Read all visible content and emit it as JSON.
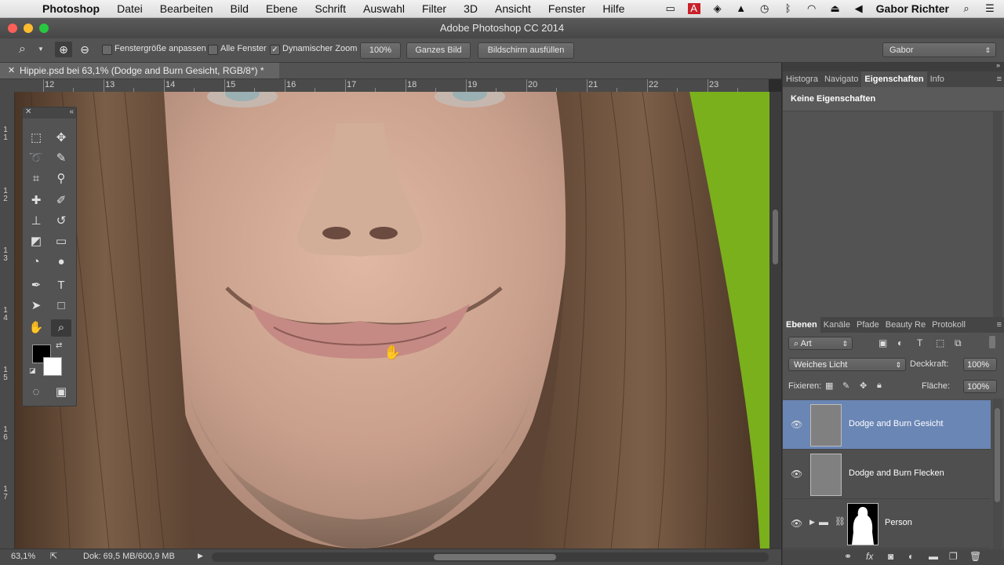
{
  "menubar": {
    "app": "Photoshop",
    "items": [
      "Datei",
      "Bearbeiten",
      "Bild",
      "Ebene",
      "Schrift",
      "Auswahl",
      "Filter",
      "3D",
      "Ansicht",
      "Fenster",
      "Hilfe"
    ],
    "user": "Gabor Richter"
  },
  "window": {
    "title": "Adobe Photoshop CC 2014"
  },
  "options": {
    "fit_window": "Fenstergröße anpassen",
    "all_windows": "Alle Fenster",
    "dynamic_zoom": "Dynamischer Zoom",
    "zoom_value": "100%",
    "fit_screen": "Ganzes Bild",
    "fill_screen": "Bildschirm ausfüllen",
    "workspace": "Gabor"
  },
  "document": {
    "tab_title": "Hippie.psd bei 63,1% (Dodge and Burn Gesicht, RGB/8*) *",
    "ruler_h": [
      "12",
      "13",
      "14",
      "15",
      "16",
      "17",
      "18",
      "19",
      "20",
      "21",
      "22",
      "23"
    ],
    "ruler_v": [
      "1 1",
      "1 2",
      "1 3",
      "1 4",
      "1 5",
      "1 6",
      "1 7"
    ]
  },
  "status": {
    "zoom": "63,1%",
    "doc": "Dok: 69,5 MB/600,9 MB"
  },
  "properties_panel": {
    "tabs": [
      "Histogra",
      "Navigato",
      "Eigenschaften",
      "Info"
    ],
    "active_tab": "Eigenschaften",
    "message": "Keine Eigenschaften"
  },
  "layers_panel": {
    "tabs": [
      "Ebenen",
      "Kanäle",
      "Pfade",
      "Beauty Re",
      "Protokoll"
    ],
    "filter": "Art",
    "blend_mode": "Weiches Licht",
    "opacity_label": "Deckkraft:",
    "opacity": "100%",
    "lock_label": "Fixieren:",
    "fill_label": "Fläche:",
    "fill": "100%",
    "layers": [
      {
        "name": "Dodge and Burn Gesicht",
        "selected": true
      },
      {
        "name": "Dodge and Burn Flecken",
        "selected": false
      },
      {
        "name": "Person",
        "selected": false
      }
    ]
  },
  "colors": {
    "accent": "#6a86b5",
    "background": "#535353"
  }
}
